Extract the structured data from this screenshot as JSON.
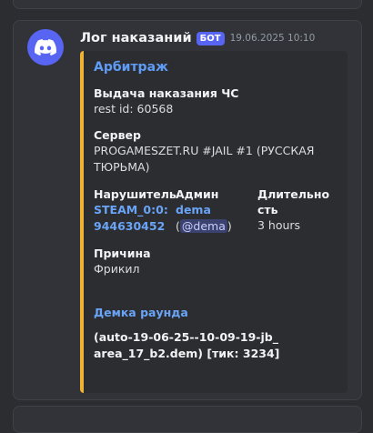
{
  "message": {
    "username": "Лог наказаний",
    "bot_tag": "БОТ",
    "timestamp": "19.06.2025 10:10",
    "avatar_icon": "discord-logo-icon",
    "accent_color": "#f0b232",
    "brand_color": "#5865f2"
  },
  "embed": {
    "title": "Арбитраж",
    "fields": {
      "punishment": {
        "name": "Выдача наказания ЧС",
        "value": "rest id: 60568"
      },
      "server": {
        "name": "Сервер",
        "value": "PROGAMESZET.RU #JAIL #1 (РУССКАЯ ТЮРЬМА)"
      },
      "offender": {
        "name": "Нарушитель",
        "line1": "STEAM_0:0:",
        "line2": "944630452"
      },
      "admin": {
        "name": "Админ",
        "value": "dema",
        "mention_open": "(",
        "mention": "@dema",
        "mention_close": ")"
      },
      "duration": {
        "name": "Длительность",
        "value": "3 hours"
      },
      "reason": {
        "name": "Причина",
        "value": "Фрикил"
      }
    },
    "demo": {
      "title": "Демка раунда",
      "value": "(auto-19-06-25--10-09-19-jb_area_17_b2.dem) [тик: 3234]"
    }
  }
}
